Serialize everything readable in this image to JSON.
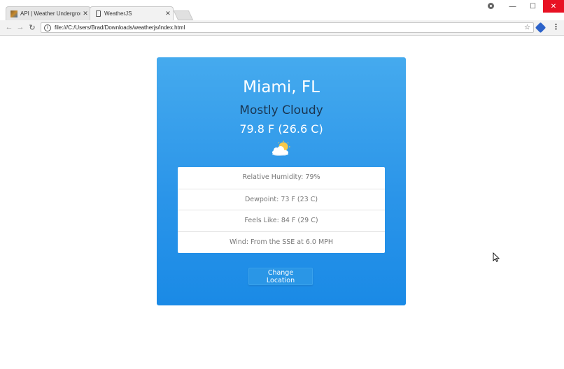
{
  "browser": {
    "tabs": [
      {
        "title": "API | Weather Undergrou",
        "active": false
      },
      {
        "title": "WeatherJS",
        "active": true
      }
    ],
    "url": "file:///C:/Users/Brad/Downloads/weatherjs/index.html",
    "window_controls": {
      "minimize": "—",
      "maximize": "☐",
      "close": "✕"
    }
  },
  "weather": {
    "location": "Miami, FL",
    "description": "Mostly Cloudy",
    "temperature": "79.8 F (26.6 C)",
    "icon": "partly-cloudy-icon",
    "details": [
      "Relative Humidity: 79%",
      "Dewpoint: 73 F (23 C)",
      "Feels Like: 84 F (29 C)",
      "Wind: From the SSE at 6.0 MPH"
    ],
    "change_location_label": "Change Location"
  },
  "colors": {
    "card_top": "#45aaee",
    "card_bottom": "#1a8ae6",
    "description_text": "#1a3550",
    "close_button": "#e81123"
  }
}
